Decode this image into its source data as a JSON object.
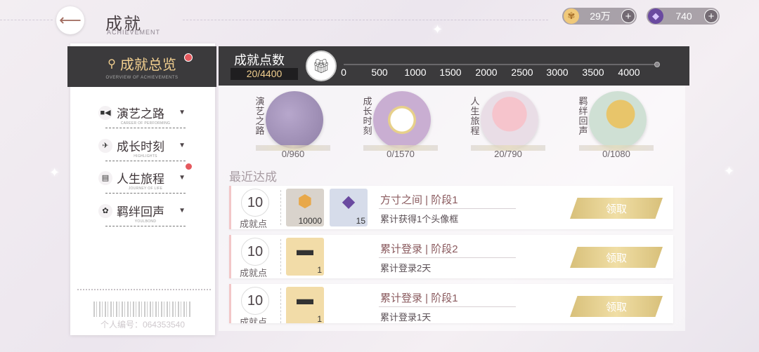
{
  "header": {
    "title": "成就",
    "subtitle": "ACHIEVEMENT"
  },
  "currencies": [
    {
      "icon": "gold-coin-icon",
      "value": "29万",
      "color": "#e8b860"
    },
    {
      "icon": "purple-crystal-icon",
      "value": "740",
      "color": "#8a5ad0"
    }
  ],
  "sidebar": {
    "overview": {
      "label": "成就总览",
      "en": "OVERVIEW OF ACHIEVEMENTS"
    },
    "items": [
      {
        "label": "演艺之路",
        "en": "CAREER OF PERFORMING",
        "icon": "video-camera-icon",
        "glyph": "■◀"
      },
      {
        "label": "成长时刻",
        "en": "HIGHLIGHTS",
        "icon": "airplane-icon",
        "glyph": "✈"
      },
      {
        "label": "人生旅程",
        "en": "JOURNEY OF LIFE",
        "icon": "passport-icon",
        "glyph": "▤"
      },
      {
        "label": "羁绊回声",
        "en": "YOULBOND",
        "icon": "flower-icon",
        "glyph": "✿"
      }
    ],
    "id_text": "个人编号：064353540"
  },
  "points": {
    "title": "成就点数",
    "value": "20/4400",
    "ticks": [
      "0",
      "500",
      "1000",
      "1500",
      "2000",
      "2500",
      "3000",
      "3500",
      "4000"
    ]
  },
  "categories": [
    {
      "label": "演艺之路",
      "progress": "0/960",
      "bg": "#8f7fa6"
    },
    {
      "label": "成长时刻",
      "progress": "0/1570",
      "bg": "#b89ac0"
    },
    {
      "label": "人生旅程",
      "progress": "20/790",
      "bg": "#e7b8c2"
    },
    {
      "label": "羁绊回声",
      "progress": "0/1080",
      "bg": "#d5c08a"
    }
  ],
  "recent": {
    "title": "最近达成",
    "points_label": "成就点",
    "claim_label": "领取",
    "rows": [
      {
        "points": "10",
        "name": "方寸之间 | 阶段1",
        "desc": "累计获得1个头像框",
        "rewards": [
          {
            "qty": "10000",
            "icon": "gold-coin-icon"
          },
          {
            "qty": "15",
            "icon": "purple-crystal-icon"
          }
        ]
      },
      {
        "points": "10",
        "name": "累计登录 | 阶段2",
        "desc": "累计登录2天",
        "rewards": [
          {
            "qty": "1",
            "icon": "ticket-card-icon"
          }
        ]
      },
      {
        "points": "10",
        "name": "累计登录 | 阶段1",
        "desc": "累计登录1天",
        "rewards": [
          {
            "qty": "1",
            "icon": "ticket-card-icon"
          }
        ]
      }
    ]
  }
}
